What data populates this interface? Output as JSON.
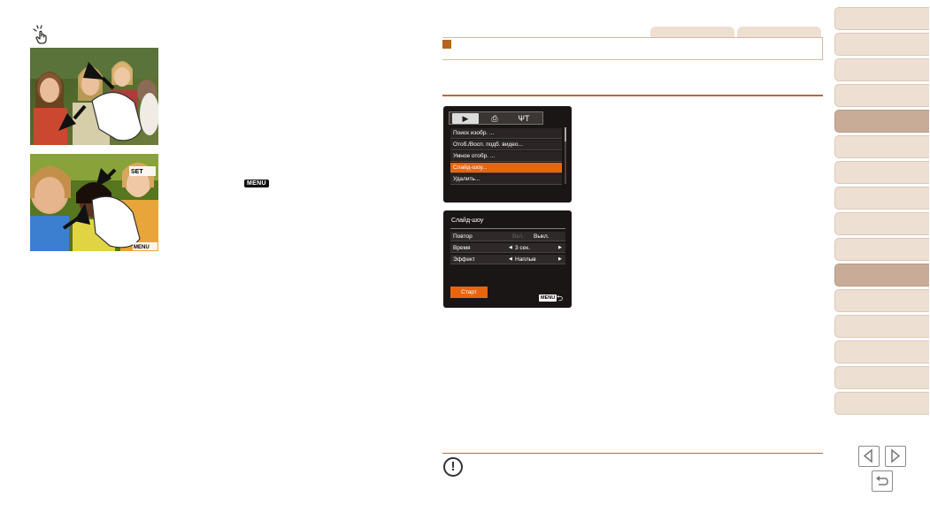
{
  "colors": {
    "accent_orange": "#e8650e",
    "rule_brown": "#b36b3a",
    "tab_beige": "#eedfd3",
    "tab_active": "#c9ac98"
  },
  "icons": {
    "touch": "touch-tap-icon",
    "note": "exclamation-circle-icon",
    "prev": "triangle-left-icon",
    "next": "triangle-right-icon",
    "home": "return-arrow-icon"
  },
  "inline_menu_label": "MENU",
  "photo2_overlay": {
    "set_label": "SET",
    "menu_label": "MENU"
  },
  "screen1": {
    "tabs": [
      "▶",
      "⎙",
      "ΨΤ"
    ],
    "items": [
      "Поиск изобр. ...",
      "Отоб./Восп. подб. видео...",
      "Умное отобр. ...",
      "Слайд-шоу...",
      "Удалить..."
    ],
    "selected_index": 3
  },
  "screen2": {
    "title": "Слайд-шоу",
    "rows": [
      {
        "label": "Повтор",
        "value_dim": "Вкл.",
        "value": "Выкл."
      },
      {
        "label": "Время",
        "value": "3 сек."
      },
      {
        "label": "Эффект",
        "value": "Наплыв"
      }
    ],
    "start_label": "Старт",
    "menu_label": "MENU"
  },
  "note_symbol": "!",
  "side_nav": {
    "count": 15,
    "active_indices": [
      4,
      10
    ]
  }
}
